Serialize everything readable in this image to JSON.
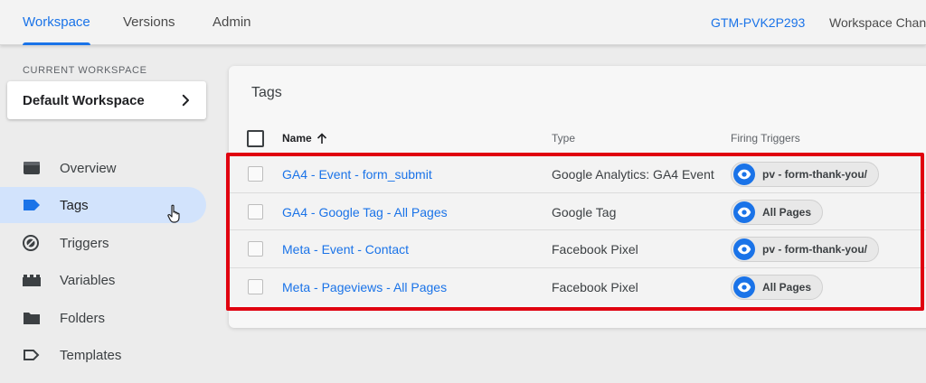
{
  "nav": {
    "tabs": [
      {
        "label": "Workspace",
        "active": true
      },
      {
        "label": "Versions",
        "active": false
      },
      {
        "label": "Admin",
        "active": false
      }
    ],
    "container_id": "GTM-PVK2P293",
    "workspace_changes": "Workspace Chan"
  },
  "sidebar": {
    "current_label": "CURRENT WORKSPACE",
    "workspace_name": "Default Workspace",
    "items": [
      {
        "label": "Overview",
        "icon": "overview-icon"
      },
      {
        "label": "Tags",
        "icon": "tag-icon",
        "active": true
      },
      {
        "label": "Triggers",
        "icon": "trigger-icon"
      },
      {
        "label": "Variables",
        "icon": "variables-icon"
      },
      {
        "label": "Folders",
        "icon": "folder-icon"
      },
      {
        "label": "Templates",
        "icon": "template-icon"
      }
    ]
  },
  "tags_panel": {
    "title": "Tags",
    "columns": {
      "name": "Name",
      "type": "Type",
      "triggers": "Firing Triggers"
    },
    "rows": [
      {
        "name": "GA4 - Event - form_submit",
        "type": "Google Analytics: GA4 Event",
        "trigger": "pv - form-thank-you/"
      },
      {
        "name": "GA4 - Google Tag - All Pages",
        "type": "Google Tag",
        "trigger": "All Pages"
      },
      {
        "name": "Meta - Event - Contact",
        "type": "Facebook Pixel",
        "trigger": "pv - form-thank-you/"
      },
      {
        "name": "Meta - Pageviews - All Pages",
        "type": "Facebook Pixel",
        "trigger": "All Pages"
      }
    ]
  },
  "colors": {
    "accent": "#1a73e8",
    "active_nav_bg": "#d2e3fc",
    "highlight_border": "#e0000f"
  }
}
